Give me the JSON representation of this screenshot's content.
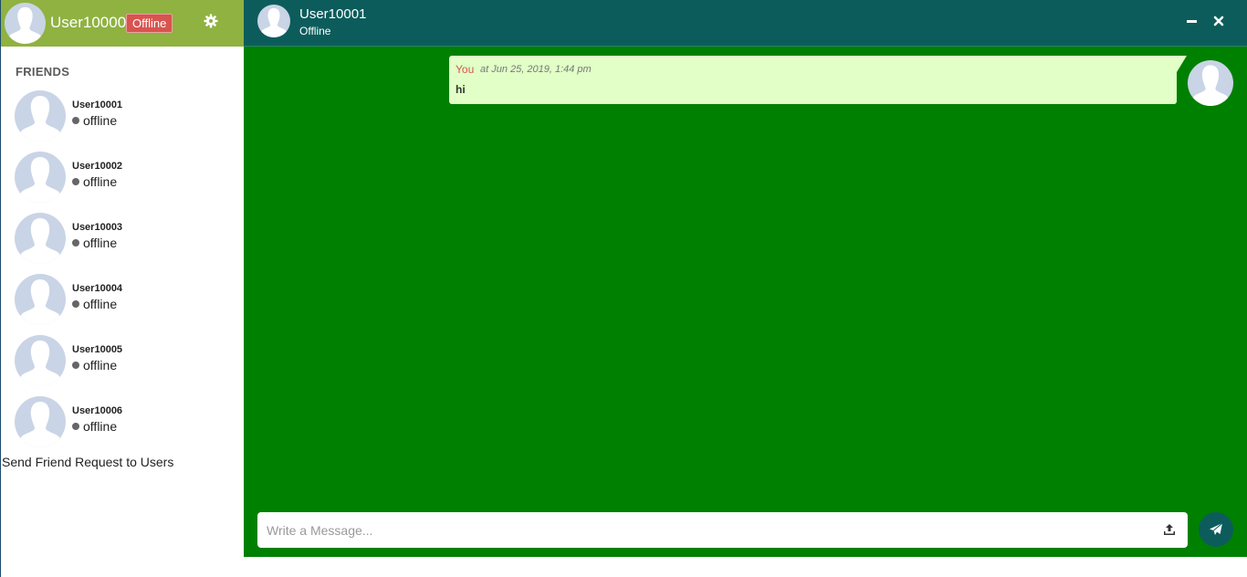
{
  "current_user": {
    "name": "User10000",
    "status": "Offline"
  },
  "icons": {
    "settings": "gear-icon",
    "minimize": "minus-icon",
    "close": "close-icon",
    "upload": "upload-icon",
    "send": "paper-plane-icon"
  },
  "colors": {
    "sidebar_header": "#8fb241",
    "chat_header": "#0d5c5c",
    "chat_background": "#008000",
    "status_badge": "#d9534f",
    "bubble": "#e1ffc7"
  },
  "sidebar": {
    "friends_title": "FRIENDS",
    "friends": [
      {
        "name": "User10001",
        "status": "offline"
      },
      {
        "name": "User10002",
        "status": "offline"
      },
      {
        "name": "User10003",
        "status": "offline"
      },
      {
        "name": "User10004",
        "status": "offline"
      },
      {
        "name": "User10005",
        "status": "offline"
      },
      {
        "name": "User10006",
        "status": "offline"
      }
    ],
    "send_request_link": "Send Friend Request to Users"
  },
  "chat": {
    "contact_name": "User10001",
    "contact_status": "Offline",
    "messages": [
      {
        "sender": "You",
        "time": "at Jun 25, 2019, 1:44 pm",
        "text": "hi"
      }
    ],
    "composer": {
      "placeholder": "Write a Message...",
      "value": ""
    }
  }
}
